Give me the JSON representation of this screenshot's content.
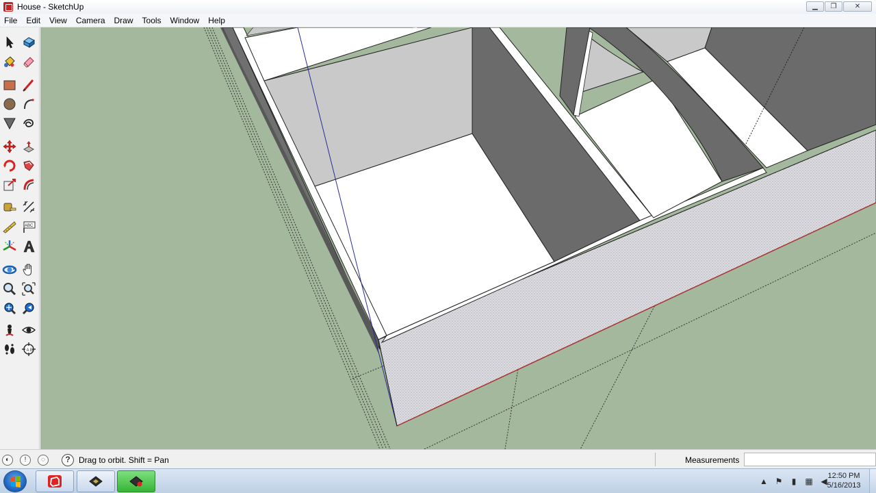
{
  "window": {
    "title": "House - SketchUp",
    "controls": {
      "minimize": "▁",
      "maximize": "❐",
      "close": "✕"
    }
  },
  "menu": [
    "File",
    "Edit",
    "View",
    "Camera",
    "Draw",
    "Tools",
    "Window",
    "Help"
  ],
  "toolbar": {
    "tools": [
      "select-tool-icon",
      "make-component-tool-icon",
      "paint-bucket-tool-icon",
      "eraser-tool-icon",
      "rectangle-tool-icon",
      "line-tool-icon",
      "circle-tool-icon",
      "arc-tool-icon",
      "polygon-tool-icon",
      "freehand-tool-icon",
      "move-tool-icon",
      "push-pull-tool-icon",
      "rotate-tool-icon",
      "follow-me-tool-icon",
      "scale-tool-icon",
      "offset-tool-icon",
      "tape-measure-tool-icon",
      "dimension-tool-icon",
      "protractor-tool-icon",
      "text-tool-icon",
      "axes-tool-icon",
      "3d-text-tool-icon",
      "orbit-tool-icon",
      "pan-tool-icon",
      "zoom-tool-icon",
      "zoom-window-tool-icon",
      "zoom-extents-tool-icon",
      "previous-view-tool-icon",
      "position-camera-tool-icon",
      "look-around-tool-icon",
      "walk-tool-icon",
      "section-plane-tool-icon"
    ]
  },
  "viewport": {
    "colors": {
      "ground": "#a3b89c",
      "floor": "#ffffff",
      "wall_light": "#c8c8c8",
      "wall_dark": "#6b6b6b",
      "foundation": "#d8d8dc",
      "guide_blue": "#2a2a9a"
    }
  },
  "statusbar": {
    "status_text": "Drag to orbit.  Shift = Pan",
    "help_icon": "?",
    "measurements_label": "Measurements",
    "measurements_value": ""
  },
  "taskbar": {
    "time": "12:50 PM",
    "date": "5/16/2013"
  }
}
